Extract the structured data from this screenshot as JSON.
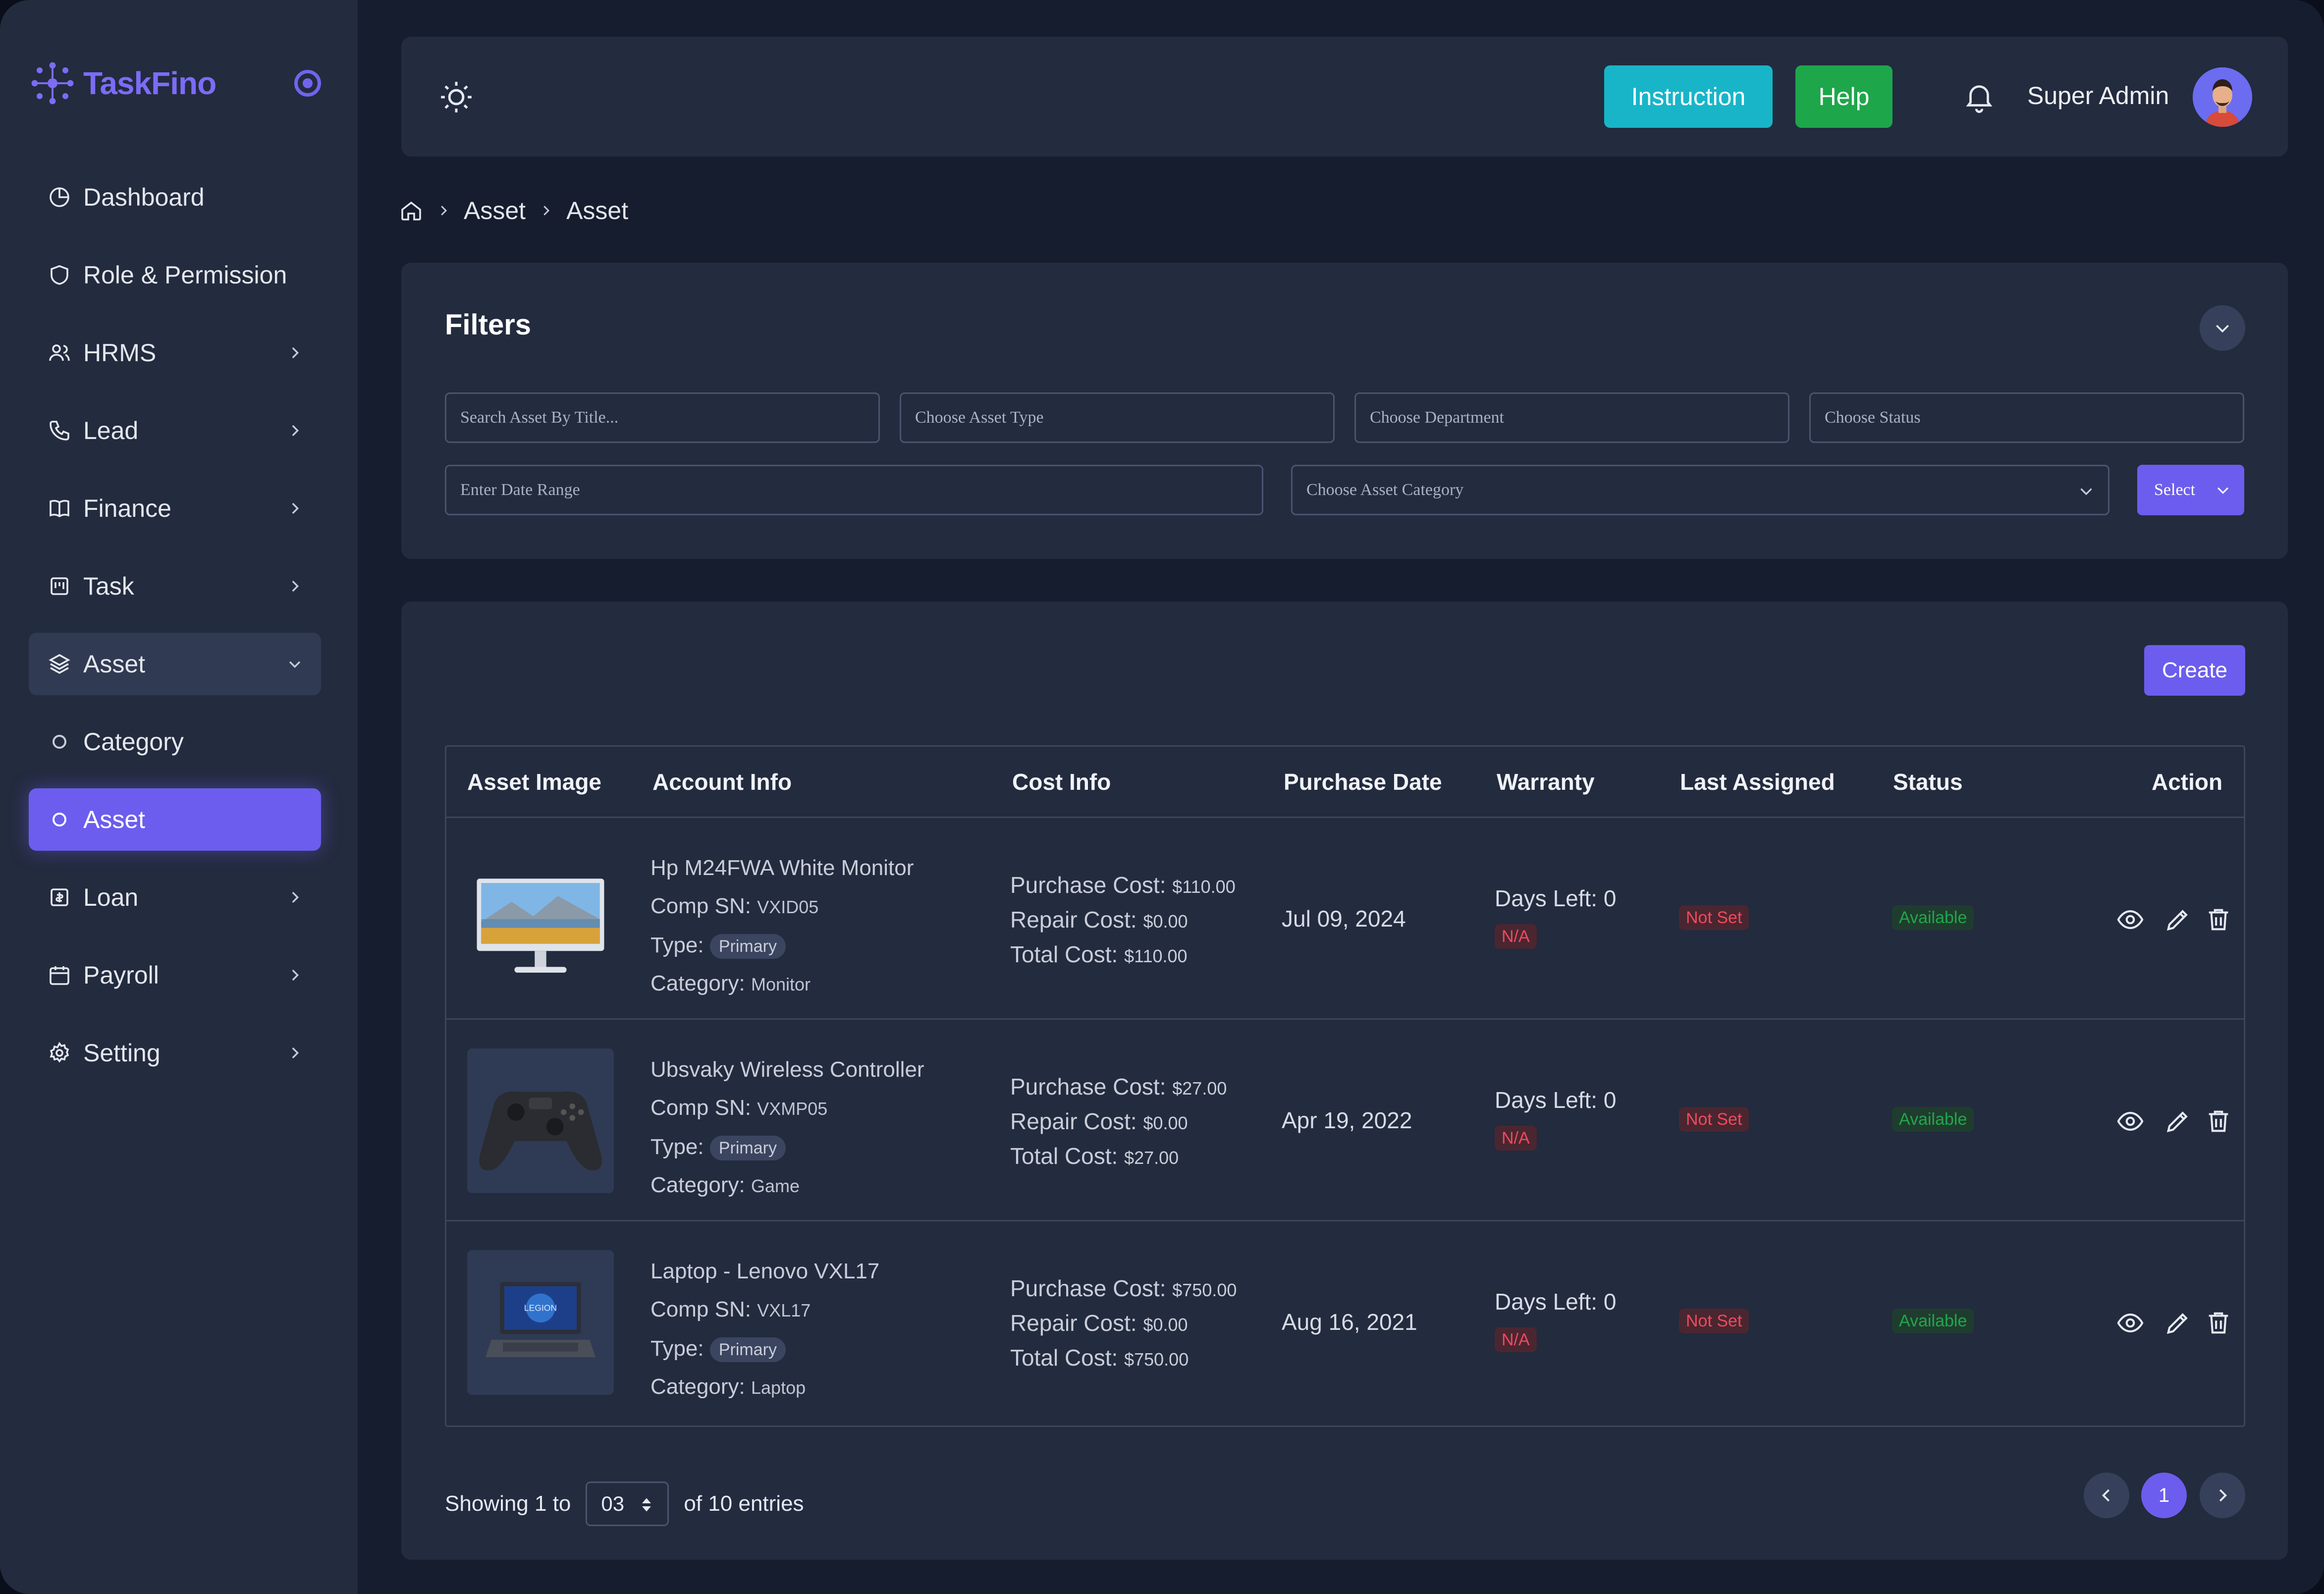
{
  "brand": {
    "name": "TaskFino",
    "accent": "#6c5dee"
  },
  "sidebar": {
    "items": [
      {
        "label": "Dashboard",
        "icon": "pie-chart-icon"
      },
      {
        "label": "Role & Permission",
        "icon": "shield-icon"
      },
      {
        "label": "HRMS",
        "icon": "users-icon"
      },
      {
        "label": "Lead",
        "icon": "phone-icon"
      },
      {
        "label": "Finance",
        "icon": "book-icon"
      },
      {
        "label": "Task",
        "icon": "kanban-icon"
      },
      {
        "label": "Asset",
        "icon": "layers-icon"
      },
      {
        "label": "Category",
        "icon": "circle-icon"
      },
      {
        "label": "Asset",
        "icon": "circle-icon"
      },
      {
        "label": "Loan",
        "icon": "loan-icon"
      },
      {
        "label": "Payroll",
        "icon": "calendar-icon"
      },
      {
        "label": "Setting",
        "icon": "gear-icon"
      }
    ]
  },
  "header": {
    "instruction_label": "Instruction",
    "help_label": "Help",
    "user_name": "Super Admin"
  },
  "breadcrumb": {
    "items": [
      "Asset",
      "Asset"
    ]
  },
  "filters": {
    "title": "Filters",
    "search_placeholder": "Search Asset By Title...",
    "asset_type_placeholder": "Choose Asset Type",
    "department_placeholder": "Choose Department",
    "status_placeholder": "Choose Status",
    "date_range_placeholder": "Enter Date Range",
    "category_placeholder": "Choose Asset Category",
    "select_label": "Select"
  },
  "table": {
    "create_label": "Create",
    "headers": [
      "Asset Image",
      "Account Info",
      "Cost Info",
      "Purchase Date",
      "Warranty",
      "Last Assigned",
      "Status",
      "Action"
    ],
    "labels": {
      "comp_sn": "Comp SN:",
      "type": "Type:",
      "category": "Category:",
      "purchase_cost": "Purchase Cost:",
      "repair_cost": "Repair Cost:",
      "total_cost": "Total Cost:"
    },
    "rows": [
      {
        "name": "Hp M24FWA White Monitor",
        "comp_sn": "VXID05",
        "type": "Primary",
        "category": "Monitor",
        "purchase_cost": "$110.00",
        "repair_cost": "$0.00",
        "total_cost": "$110.00",
        "purchase_date": "Jul 09, 2024",
        "days_left": "Days Left: 0",
        "warranty_badge": "N/A",
        "last_assigned": "Not Set",
        "status": "Available"
      },
      {
        "name": "Ubsvaky Wireless Controller",
        "comp_sn": "VXMP05",
        "type": "Primary",
        "category": "Game",
        "purchase_cost": "$27.00",
        "repair_cost": "$0.00",
        "total_cost": "$27.00",
        "purchase_date": "Apr 19, 2022",
        "days_left": "Days Left: 0",
        "warranty_badge": "N/A",
        "last_assigned": "Not Set",
        "status": "Available"
      },
      {
        "name": "Laptop - Lenovo VXL17",
        "comp_sn": "VXL17",
        "type": "Primary",
        "category": "Laptop",
        "purchase_cost": "$750.00",
        "repair_cost": "$0.00",
        "total_cost": "$750.00",
        "purchase_date": "Aug 16, 2021",
        "days_left": "Days Left: 0",
        "warranty_badge": "N/A",
        "last_assigned": "Not Set",
        "status": "Available"
      }
    ]
  },
  "pagination": {
    "showing_prefix": "Showing 1 to",
    "per_page": "03",
    "showing_suffix": "of 10 entries",
    "current_page": "1"
  }
}
